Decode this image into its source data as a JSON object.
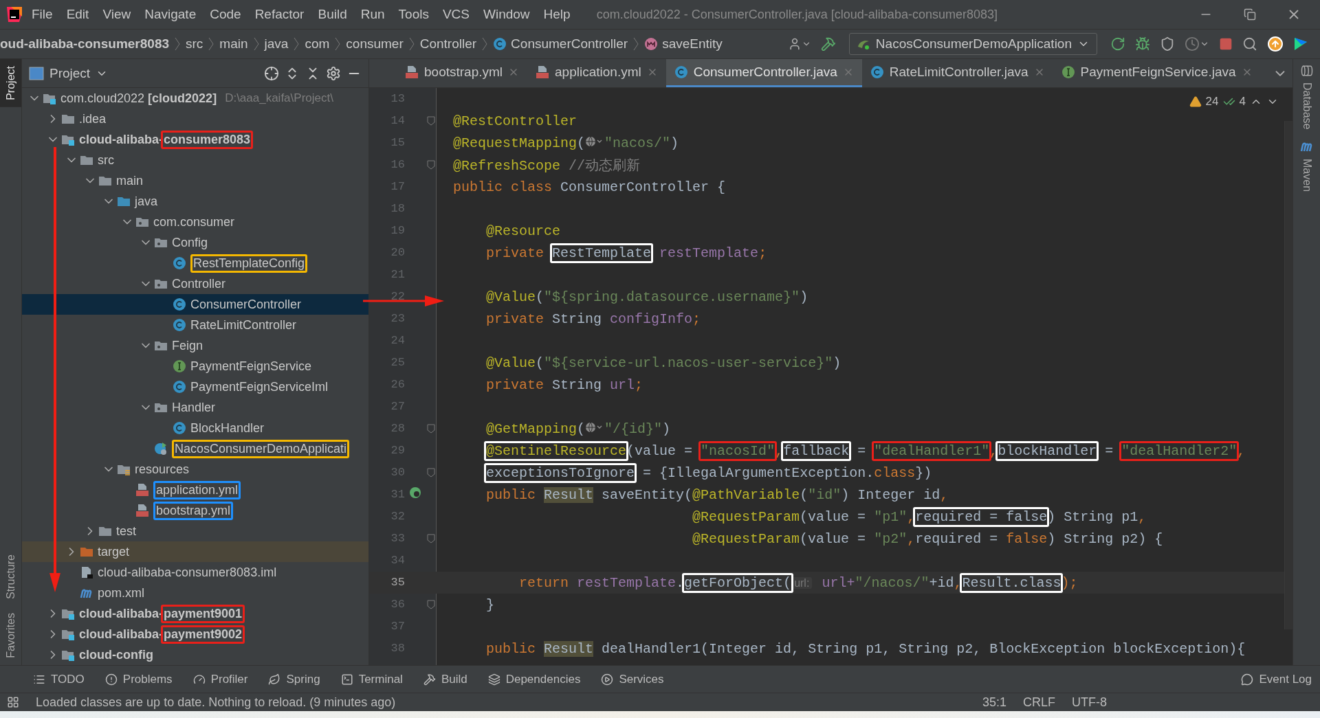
{
  "menu": [
    "File",
    "Edit",
    "View",
    "Navigate",
    "Code",
    "Refactor",
    "Build",
    "Run",
    "Tools",
    "VCS",
    "Window",
    "Help"
  ],
  "window": {
    "title": "com.cloud2022 - ConsumerController.java [cloud-alibaba-consumer8083]"
  },
  "breadcrumbs": [
    {
      "label": "oud-alibaba-consumer8083",
      "kind": "module"
    },
    {
      "label": "src",
      "kind": "folder"
    },
    {
      "label": "main",
      "kind": "folder"
    },
    {
      "label": "java",
      "kind": "folder"
    },
    {
      "label": "com",
      "kind": "folder"
    },
    {
      "label": "consumer",
      "kind": "folder"
    },
    {
      "label": "Controller",
      "kind": "folder"
    },
    {
      "label": "ConsumerController",
      "kind": "class"
    },
    {
      "label": "saveEntity",
      "kind": "method"
    }
  ],
  "run_config": "NacosConsumerDemoApplication",
  "left_stripe": [
    {
      "label": "Project",
      "selected": true
    },
    {
      "label": "Structure",
      "selected": false
    },
    {
      "label": "Favorites",
      "selected": false
    }
  ],
  "project_panel": {
    "title": "Project",
    "tree": [
      {
        "label": "com.cloud2022 **[cloud2022]**",
        "path": "D:\\aaa_kaifa\\Project\\",
        "kind": "module",
        "expanded": true,
        "selected": false,
        "children": [
          {
            "label": ".idea",
            "kind": "folder",
            "expanded": false,
            "selected": false
          },
          {
            "prefix": "cloud-alibaba-",
            "label": "consumer8083",
            "color": "#e8201a",
            "kind": "module",
            "expanded": true,
            "selected": false,
            "children": [
              {
                "label": "src",
                "kind": "folder",
                "expanded": true,
                "selected": false,
                "children": [
                  {
                    "label": "main",
                    "kind": "folder",
                    "expanded": true,
                    "selected": false,
                    "children": [
                      {
                        "label": "java",
                        "kind": "source",
                        "expanded": true,
                        "selected": false,
                        "children": [
                          {
                            "label": "com.consumer",
                            "kind": "package",
                            "expanded": true,
                            "selected": false,
                            "children": [
                              {
                                "label": "Config",
                                "kind": "package",
                                "expanded": true,
                                "selected": false,
                                "children": [
                                  {
                                    "label": "RestTemplateConfig",
                                    "kind": "class",
                                    "color": "#f5b800",
                                    "selected": false
                                  }
                                ]
                              },
                              {
                                "label": "Controller",
                                "kind": "package",
                                "expanded": true,
                                "selected": false,
                                "children": [
                                  {
                                    "label": "ConsumerController",
                                    "kind": "class",
                                    "selected": true
                                  },
                                  {
                                    "label": "RateLimitController",
                                    "kind": "class",
                                    "selected": false
                                  }
                                ]
                              },
                              {
                                "label": "Feign",
                                "kind": "package",
                                "expanded": true,
                                "selected": false,
                                "children": [
                                  {
                                    "label": "PaymentFeignService",
                                    "kind": "interface",
                                    "selected": false
                                  },
                                  {
                                    "label": "PaymentFeignServiceIml",
                                    "kind": "class",
                                    "selected": false
                                  }
                                ]
                              },
                              {
                                "label": "Handler",
                                "kind": "package",
                                "expanded": true,
                                "selected": false,
                                "children": [
                                  {
                                    "label": "BlockHandler",
                                    "kind": "class",
                                    "selected": false
                                  }
                                ]
                              },
                              {
                                "label": "NacosConsumerDemoApplicati",
                                "kind": "app",
                                "color": "#f5b800",
                                "selected": false
                              }
                            ]
                          }
                        ]
                      },
                      {
                        "label": "resources",
                        "kind": "resources",
                        "expanded": true,
                        "selected": false,
                        "children": [
                          {
                            "label": "application.yml",
                            "kind": "yml",
                            "color": "#1e90ff",
                            "selected": false
                          },
                          {
                            "label": "bootstrap.yml",
                            "kind": "yml",
                            "color": "#1e90ff",
                            "selected": false
                          }
                        ]
                      }
                    ]
                  },
                  {
                    "label": "test",
                    "kind": "folder",
                    "expanded": false,
                    "selected": false
                  }
                ]
              },
              {
                "label": "target",
                "kind": "excluded",
                "expanded": false,
                "selected": false
              },
              {
                "label": "cloud-alibaba-consumer8083.iml",
                "kind": "iml",
                "selected": false
              },
              {
                "label": "pom.xml",
                "kind": "maven",
                "selected": false
              }
            ]
          },
          {
            "prefix": "cloud-alibaba-",
            "label": "payment9001",
            "color": "#e8201a",
            "kind": "module",
            "expanded": false,
            "selected": false
          },
          {
            "prefix": "cloud-alibaba-",
            "label": "payment9002",
            "color": "#e8201a",
            "kind": "module",
            "expanded": false,
            "selected": false
          },
          {
            "label": "cloud-config",
            "kind": "module",
            "expanded": false,
            "selected": false
          }
        ]
      }
    ]
  },
  "editor_tabs": [
    {
      "label": "bootstrap.yml",
      "kind": "yml",
      "selected": false
    },
    {
      "label": "application.yml",
      "kind": "yml",
      "selected": false
    },
    {
      "label": "ConsumerController.java",
      "kind": "class",
      "selected": true
    },
    {
      "label": "RateLimitController.java",
      "kind": "class",
      "selected": false
    },
    {
      "label": "PaymentFeignService.java",
      "kind": "interface",
      "selected": false
    }
  ],
  "inspections": {
    "warnings": "24",
    "passed": "4"
  },
  "code_lines": [
    {
      "number": "13",
      "fold": false,
      "current": false
    },
    {
      "number": "14",
      "fold": true,
      "current": false,
      "tokens": [
        {
          "text": "@RestController",
          "kind": "ann"
        }
      ]
    },
    {
      "number": "15",
      "fold": false,
      "current": false,
      "tokens": [
        {
          "text": "@RequestMapping",
          "kind": "ann"
        },
        {
          "text": "(",
          "kind": "plain"
        },
        {
          "kind": "globe"
        },
        {
          "text": "\"nacos/\"",
          "kind": "str"
        },
        {
          "text": ")",
          "kind": "plain"
        }
      ]
    },
    {
      "number": "16",
      "fold": true,
      "current": false,
      "tokens": [
        {
          "text": "@RefreshScope",
          "kind": "ann"
        },
        {
          "text": " //动态刷新",
          "kind": "comment"
        }
      ]
    },
    {
      "number": "17",
      "fold": false,
      "current": false,
      "tokens": [
        {
          "text": "public class ",
          "kind": "kw"
        },
        {
          "text": "ConsumerController {",
          "kind": "plain"
        }
      ]
    },
    {
      "number": "18",
      "fold": false,
      "current": false
    },
    {
      "number": "19",
      "fold": false,
      "current": false,
      "tokens": [
        {
          "text": "    @Resource",
          "kind": "ann"
        }
      ]
    },
    {
      "number": "20",
      "fold": false,
      "current": false,
      "tokens": [
        {
          "text": "    private ",
          "kind": "kw"
        },
        {
          "text": "RestTemplate",
          "kind": "plain",
          "color": "#ffffff"
        },
        {
          "text": " restTemplate",
          "kind": "field"
        },
        {
          "text": ";",
          "kind": "kw"
        }
      ]
    },
    {
      "number": "21",
      "fold": false,
      "current": false
    },
    {
      "number": "22",
      "fold": false,
      "current": false,
      "tokens": [
        {
          "text": "    @Value",
          "kind": "ann"
        },
        {
          "text": "(",
          "kind": "plain"
        },
        {
          "text": "\"${spring.datasource.username}\"",
          "kind": "str"
        },
        {
          "text": ")",
          "kind": "plain"
        }
      ]
    },
    {
      "number": "23",
      "fold": false,
      "current": false,
      "tokens": [
        {
          "text": "    private ",
          "kind": "kw"
        },
        {
          "text": "String ",
          "kind": "plain"
        },
        {
          "text": "configInfo",
          "kind": "field"
        },
        {
          "text": ";",
          "kind": "kw"
        }
      ]
    },
    {
      "number": "24",
      "fold": false,
      "current": false
    },
    {
      "number": "25",
      "fold": false,
      "current": false,
      "tokens": [
        {
          "text": "    @Value",
          "kind": "ann"
        },
        {
          "text": "(",
          "kind": "plain"
        },
        {
          "text": "\"${service-url.nacos-user-service}\"",
          "kind": "str"
        },
        {
          "text": ")",
          "kind": "plain"
        }
      ]
    },
    {
      "number": "26",
      "fold": false,
      "current": false,
      "tokens": [
        {
          "text": "    private ",
          "kind": "kw"
        },
        {
          "text": "String ",
          "kind": "plain"
        },
        {
          "text": "url",
          "kind": "field"
        },
        {
          "text": ";",
          "kind": "kw"
        }
      ]
    },
    {
      "number": "27",
      "fold": false,
      "current": false
    },
    {
      "number": "28",
      "fold": true,
      "current": false,
      "tokens": [
        {
          "text": "    @GetMapping",
          "kind": "ann"
        },
        {
          "text": "(",
          "kind": "plain"
        },
        {
          "kind": "globe"
        },
        {
          "text": "\"/{id}\"",
          "kind": "str"
        },
        {
          "text": ")",
          "kind": "plain"
        }
      ]
    },
    {
      "number": "29",
      "fold": false,
      "current": false,
      "tokens": [
        {
          "text": "    @SentinelResource",
          "kind": "ann",
          "color": "#ffffff"
        },
        {
          "text": "(value = ",
          "kind": "plain"
        },
        {
          "text": "\"nacosId\"",
          "kind": "str",
          "color": "#e8201a"
        },
        {
          "text": ",",
          "kind": "kw"
        },
        {
          "text": "fallback",
          "kind": "plain",
          "color": "#ffffff"
        },
        {
          "text": " = ",
          "kind": "plain"
        },
        {
          "text": "\"dealHandler1\"",
          "kind": "str",
          "color": "#e8201a"
        },
        {
          "text": ",",
          "kind": "kw"
        },
        {
          "text": "blockHandler",
          "kind": "plain",
          "color": "#ffffff"
        },
        {
          "text": " = ",
          "kind": "plain"
        },
        {
          "text": "\"dealHandler2\"",
          "kind": "str",
          "color": "#e8201a"
        },
        {
          "text": ",",
          "kind": "kw"
        }
      ]
    },
    {
      "number": "30",
      "fold": true,
      "current": false,
      "tokens": [
        {
          "text": "    exceptionsToIgnore",
          "kind": "plain",
          "color": "#ffffff"
        },
        {
          "text": " = {IllegalArgumentException.",
          "kind": "plain"
        },
        {
          "text": "class",
          "kind": "kw"
        },
        {
          "text": "})",
          "kind": "plain"
        }
      ]
    },
    {
      "number": "31",
      "fold": false,
      "current": false,
      "gutter": {
        "kind": "web"
      },
      "tokens": [
        {
          "text": "    public ",
          "kind": "kw"
        },
        {
          "text": "Result",
          "kind": "usage"
        },
        {
          "text": " saveEntity(",
          "kind": "plain"
        },
        {
          "text": "@PathVariable",
          "kind": "ann"
        },
        {
          "text": "(",
          "kind": "plain"
        },
        {
          "text": "\"id\"",
          "kind": "str"
        },
        {
          "text": ") Integer id",
          "kind": "plain"
        },
        {
          "text": ",",
          "kind": "kw"
        }
      ]
    },
    {
      "number": "32",
      "fold": false,
      "current": false,
      "tokens": [
        {
          "text": "                             @RequestParam",
          "kind": "ann"
        },
        {
          "text": "(value = ",
          "kind": "plain"
        },
        {
          "text": "\"p1\"",
          "kind": "str"
        },
        {
          "text": ",",
          "kind": "kw"
        },
        {
          "text": "required = false",
          "kind": "plain",
          "color": "#ffffff"
        },
        {
          "text": ") String p1",
          "kind": "plain"
        },
        {
          "text": ",",
          "kind": "kw"
        }
      ]
    },
    {
      "number": "33",
      "fold": true,
      "current": false,
      "tokens": [
        {
          "text": "                             @RequestParam",
          "kind": "ann"
        },
        {
          "text": "(value = ",
          "kind": "plain"
        },
        {
          "text": "\"p2\"",
          "kind": "str"
        },
        {
          "text": ",",
          "kind": "kw"
        },
        {
          "text": "required = ",
          "kind": "plain"
        },
        {
          "text": "false",
          "kind": "kw"
        },
        {
          "text": ") String p2) {",
          "kind": "plain"
        }
      ]
    },
    {
      "number": "34",
      "fold": false,
      "current": false
    },
    {
      "number": "35",
      "fold": false,
      "current": true,
      "tokens": [
        {
          "text": "        return ",
          "kind": "kw"
        },
        {
          "text": "restTemplate",
          "kind": "field"
        },
        {
          "text": ".",
          "kind": "plain"
        },
        {
          "text": "getForObject(",
          "kind": "plain",
          "color": "#ffffff"
        },
        {
          "text": "url:",
          "kind": "hint"
        },
        {
          "text": " url+",
          "kind": "field"
        },
        {
          "text": "\"/nacos/\"",
          "kind": "str"
        },
        {
          "text": "+id",
          "kind": "plain"
        },
        {
          "text": ",",
          "kind": "kw"
        },
        {
          "text": "Result.class",
          "kind": "plain",
          "color": "#ffffff"
        },
        {
          "text": ");",
          "kind": "kw"
        }
      ]
    },
    {
      "number": "36",
      "fold": true,
      "current": false,
      "tokens": [
        {
          "text": "    }",
          "kind": "plain"
        }
      ]
    },
    {
      "number": "37",
      "fold": false,
      "current": false
    },
    {
      "number": "38",
      "fold": false,
      "current": false,
      "tokens": [
        {
          "text": "    public ",
          "kind": "kw"
        },
        {
          "text": "Result",
          "kind": "usage"
        },
        {
          "text": " dealHandler1(Integer id, String p1, String p2, BlockException blockException){",
          "kind": "plain"
        }
      ]
    }
  ],
  "right_stripe": [
    {
      "label": "Database",
      "kind": "database"
    },
    {
      "label": "Maven",
      "kind": "maven"
    }
  ],
  "tool_windows": [
    {
      "label": "TODO",
      "kind": "todo"
    },
    {
      "label": "Problems",
      "kind": "problems"
    },
    {
      "label": "Profiler",
      "kind": "profiler"
    },
    {
      "label": "Spring",
      "kind": "spring"
    },
    {
      "label": "Terminal",
      "kind": "terminal"
    },
    {
      "label": "Build",
      "kind": "build"
    },
    {
      "label": "Dependencies",
      "kind": "dependencies"
    },
    {
      "label": "Services",
      "kind": "services"
    }
  ],
  "event_log": "Event Log",
  "status_bar": {
    "message": "Loaded classes are up to date. Nothing to reload. (9 minutes ago)",
    "position": "35:1",
    "line_separator": "CRLF",
    "encoding": "UTF-8"
  }
}
